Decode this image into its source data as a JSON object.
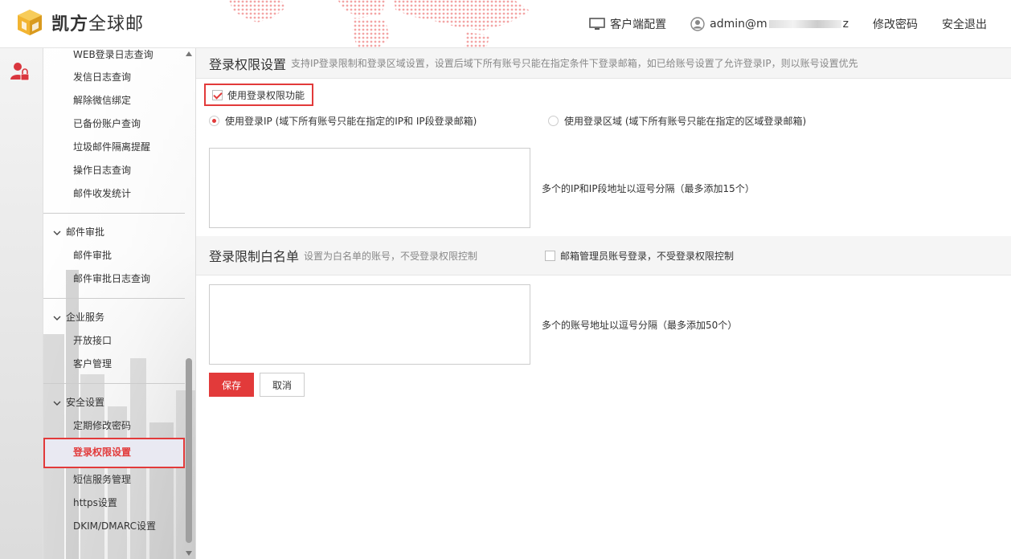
{
  "header": {
    "brand_bold": "凯方",
    "brand_rest": "全球邮",
    "client_config": "客户端配置",
    "user_prefix": "admin@m",
    "user_suffix": "z",
    "change_password": "修改密码",
    "logout": "安全退出"
  },
  "sidebar": {
    "group1_items": [
      "WEB登录日志查询",
      "发信日志查询",
      "解除微信绑定",
      "已备份账户查询",
      "垃圾邮件隔离提醒",
      "操作日志查询",
      "邮件收发统计"
    ],
    "group2_label": "邮件审批",
    "group2_items": [
      "邮件审批",
      "邮件审批日志查询"
    ],
    "group3_label": "企业服务",
    "group3_items": [
      "开放接口",
      "客户管理"
    ],
    "group4_label": "安全设置",
    "group4_items": [
      "定期修改密码",
      "登录权限设置",
      "短信服务管理",
      "https设置",
      "DKIM/DMARC设置"
    ],
    "active_item": "登录权限设置"
  },
  "main": {
    "section1_title": "登录权限设置",
    "section1_desc": "支持IP登录限制和登录区域设置，设置后域下所有账号只能在指定条件下登录邮箱，如已给账号设置了允许登录IP，则以账号设置优先",
    "enable_label": "使用登录权限功能",
    "enable_checked": true,
    "radio_ip_label": "使用登录IP (域下所有账号只能在指定的IP和 IP段登录邮箱)",
    "radio_region_label": "使用登录区域 (域下所有账号只能在指定的区域登录邮箱)",
    "selected_mode": "ip",
    "ip_textarea_value": "",
    "ip_hint": "多个的IP和IP段地址以逗号分隔（最多添加15个）",
    "section2_title": "登录限制白名单",
    "section2_desc": "设置为白名单的账号，不受登录权限控制",
    "admin_exempt_label": "邮箱管理员账号登录，不受登录权限控制",
    "admin_exempt_checked": false,
    "whitelist_textarea_value": "",
    "whitelist_hint": "多个的账号地址以逗号分隔（最多添加50个）",
    "save_label": "保存",
    "cancel_label": "取消"
  },
  "colors": {
    "accent": "#e23a3a"
  }
}
